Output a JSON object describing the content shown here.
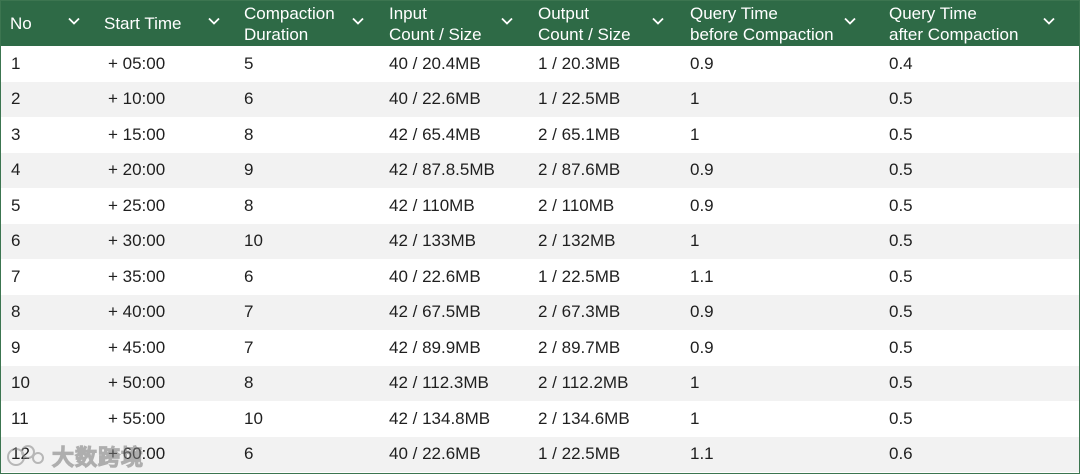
{
  "table": {
    "columns": [
      {
        "label": "No"
      },
      {
        "label": "Start Time"
      },
      {
        "label": "Compaction\nDuration"
      },
      {
        "label": "Input\nCount / Size"
      },
      {
        "label": "Output\nCount / Size"
      },
      {
        "label": "Query Time\nbefore Compaction"
      },
      {
        "label": "Query Time\nafter Compaction"
      }
    ],
    "rows": [
      [
        "1",
        "+ 05:00",
        "5",
        "40 / 20.4MB",
        "1 / 20.3MB",
        "0.9",
        "0.4"
      ],
      [
        "2",
        "+ 10:00",
        "6",
        "40 / 22.6MB",
        "1 / 22.5MB",
        "1",
        "0.5"
      ],
      [
        "3",
        "+ 15:00",
        "8",
        "42 / 65.4MB",
        "2 / 65.1MB",
        "1",
        "0.5"
      ],
      [
        "4",
        "+ 20:00",
        "9",
        "42 / 87.8.5MB",
        "2 / 87.6MB",
        "0.9",
        "0.5"
      ],
      [
        "5",
        "+ 25:00",
        "8",
        "42 / 110MB",
        "2 / 110MB",
        "0.9",
        "0.5"
      ],
      [
        "6",
        "+ 30:00",
        "10",
        "42 / 133MB",
        "2 / 132MB",
        "1",
        "0.5"
      ],
      [
        "7",
        "+ 35:00",
        "6",
        "40 / 22.6MB",
        "1 / 22.5MB",
        "1.1",
        "0.5"
      ],
      [
        "8",
        "+ 40:00",
        "7",
        "42 / 67.5MB",
        "2 / 67.3MB",
        "0.9",
        "0.5"
      ],
      [
        "9",
        "+ 45:00",
        "7",
        "42 / 89.9MB",
        "2 / 89.7MB",
        "0.9",
        "0.5"
      ],
      [
        "10",
        "+ 50:00",
        "8",
        "42 / 112.3MB",
        "2 / 112.2MB",
        "1",
        "0.5"
      ],
      [
        "11",
        "+ 55:00",
        "10",
        "42 / 134.8MB",
        "2 / 134.6MB",
        "1",
        "0.5"
      ],
      [
        "12",
        "+ 60:00",
        "6",
        "40 / 22.6MB",
        "1 / 22.5MB",
        "1.1",
        "0.6"
      ]
    ]
  },
  "colors": {
    "header_bg": "#2e6a46",
    "header_text": "#ffffff",
    "row_alt_bg": "#f2f2f2"
  },
  "icons": {
    "sort": "chevron-down-icon",
    "watermark_logo": "watermark-logo-icon"
  },
  "watermark": {
    "text": "大数跨境"
  }
}
